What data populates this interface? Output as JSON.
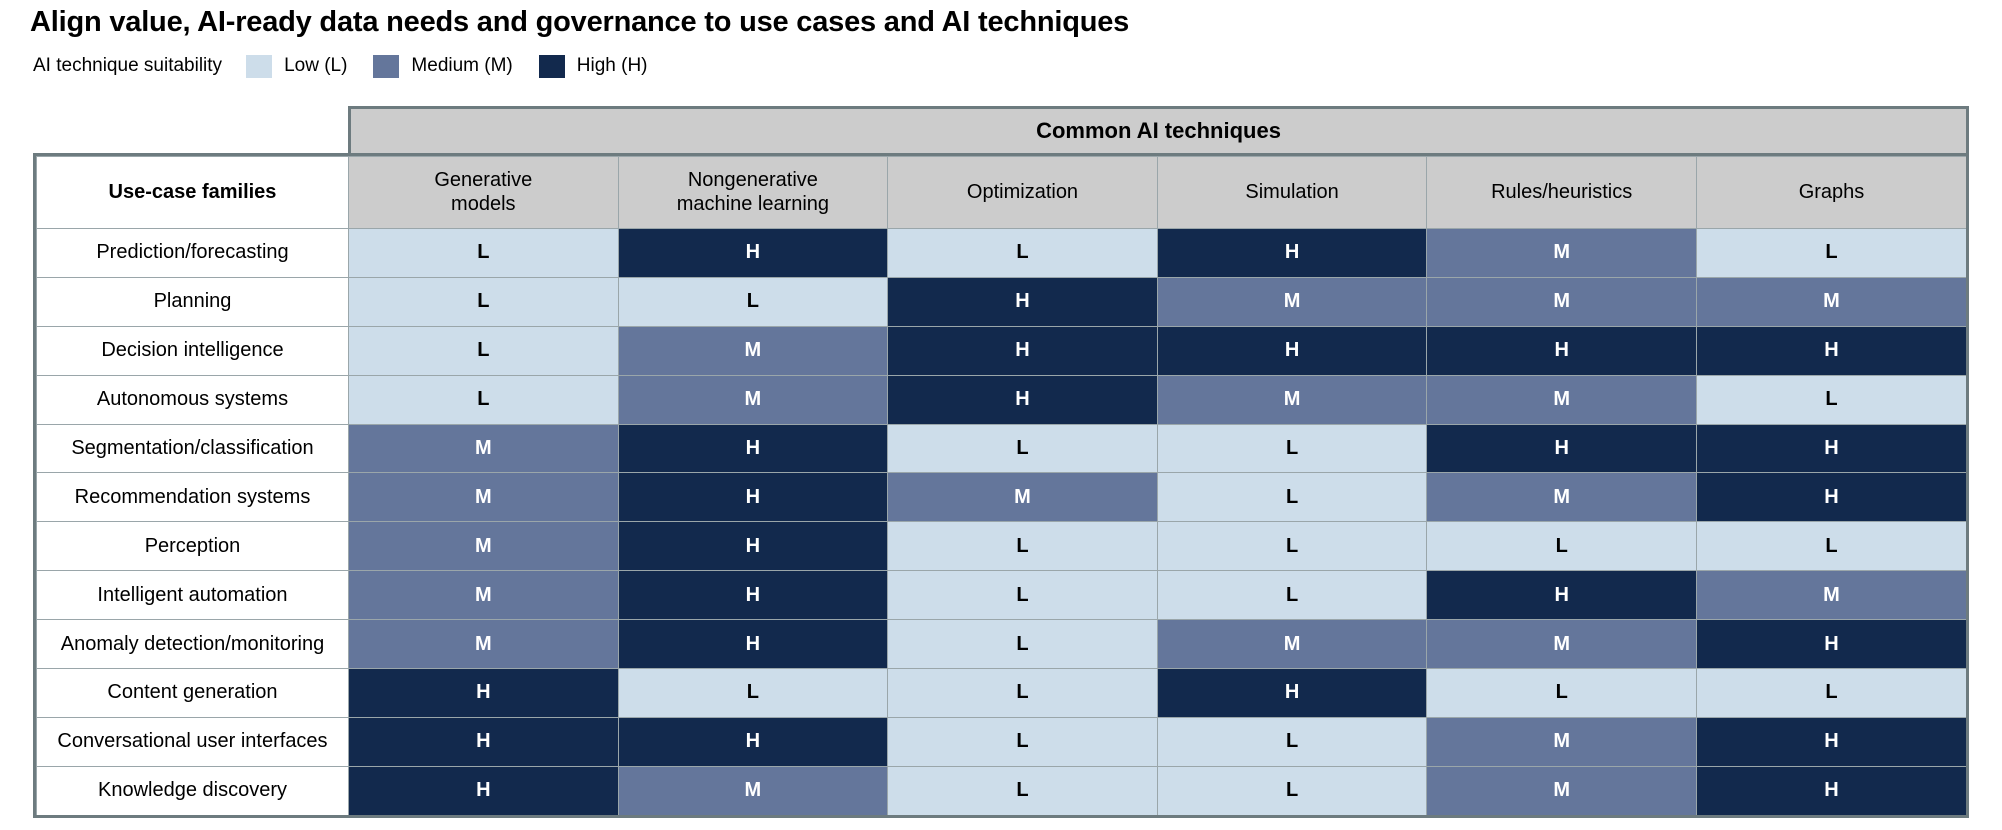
{
  "title": "Align value, AI-ready data needs and governance to use cases and AI techniques",
  "legend": {
    "title": "AI technique suitability",
    "items": [
      {
        "label": "Low (L)",
        "code": "L",
        "color": "#cdddea"
      },
      {
        "label": "Medium (M)",
        "code": "M",
        "color": "#64769b"
      },
      {
        "label": "High (H)",
        "code": "H",
        "color": "#12294d"
      }
    ]
  },
  "chart_data": {
    "type": "heatmap",
    "title": "Align value, AI-ready data needs and governance to use cases and AI techniques",
    "banner_label": "Common AI techniques",
    "row_header_label": "Use-case families",
    "xlabel": "Common AI techniques",
    "ylabel": "Use-case families",
    "legend_position": "top-left",
    "grid": true,
    "scale": {
      "L": {
        "label": "Low (L)",
        "value": 1,
        "color": "#cdddea"
      },
      "M": {
        "label": "Medium (M)",
        "value": 2,
        "color": "#64769b"
      },
      "H": {
        "label": "High (H)",
        "value": 3,
        "color": "#12294d"
      }
    },
    "columns": [
      "Generative models",
      "Nongenerative machine learning",
      "Optimization",
      "Simulation",
      "Rules/heuristics",
      "Graphs"
    ],
    "column_lines": [
      [
        "Generative",
        "models"
      ],
      [
        "Nongenerative",
        "machine learning"
      ],
      [
        "Optimization",
        ""
      ],
      [
        "Simulation",
        ""
      ],
      [
        "Rules/heuristics",
        ""
      ],
      [
        "Graphs",
        ""
      ]
    ],
    "categories": [
      "Prediction/forecasting",
      "Planning",
      "Decision intelligence",
      "Autonomous systems",
      "Segmentation/classification",
      "Recommendation systems",
      "Perception",
      "Intelligent automation",
      "Anomaly detection/monitoring",
      "Content generation",
      "Conversational user interfaces",
      "Knowledge discovery"
    ],
    "rows": [
      {
        "label": "Prediction/forecasting",
        "values": [
          "L",
          "H",
          "L",
          "H",
          "M",
          "L"
        ]
      },
      {
        "label": "Planning",
        "values": [
          "L",
          "L",
          "H",
          "M",
          "M",
          "M"
        ]
      },
      {
        "label": "Decision intelligence",
        "values": [
          "L",
          "M",
          "H",
          "H",
          "H",
          "H"
        ]
      },
      {
        "label": "Autonomous systems",
        "values": [
          "L",
          "M",
          "H",
          "M",
          "M",
          "L"
        ]
      },
      {
        "label": "Segmentation/classification",
        "values": [
          "M",
          "H",
          "L",
          "L",
          "H",
          "H"
        ]
      },
      {
        "label": "Recommendation systems",
        "values": [
          "M",
          "H",
          "M",
          "L",
          "M",
          "H"
        ]
      },
      {
        "label": "Perception",
        "values": [
          "M",
          "H",
          "L",
          "L",
          "L",
          "L"
        ]
      },
      {
        "label": "Intelligent automation",
        "values": [
          "M",
          "H",
          "L",
          "L",
          "H",
          "M"
        ]
      },
      {
        "label": "Anomaly detection/monitoring",
        "values": [
          "M",
          "H",
          "L",
          "M",
          "M",
          "H"
        ]
      },
      {
        "label": "Content generation",
        "values": [
          "H",
          "L",
          "L",
          "H",
          "L",
          "L"
        ]
      },
      {
        "label": "Conversational user interfaces",
        "values": [
          "H",
          "H",
          "L",
          "L",
          "M",
          "H"
        ]
      },
      {
        "label": "Knowledge discovery",
        "values": [
          "H",
          "M",
          "L",
          "L",
          "M",
          "H"
        ]
      }
    ]
  }
}
